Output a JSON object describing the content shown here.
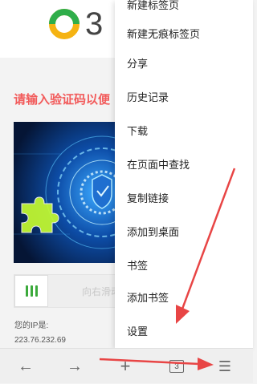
{
  "site": {
    "logo_text": "3",
    "captcha_title": "请输入验证码以便",
    "slider_hint": "向右滑动",
    "ip_label": "您的IP是:",
    "ip_value": "223.76.232.69"
  },
  "menu": {
    "items": [
      {
        "label": "新建标签页"
      },
      {
        "label": "新建无痕标签页"
      },
      {
        "label": "分享"
      },
      {
        "label": "历史记录"
      },
      {
        "label": "下载"
      },
      {
        "label": "在页面中查找"
      },
      {
        "label": "复制链接"
      },
      {
        "label": "添加到桌面"
      },
      {
        "label": "书签"
      },
      {
        "label": "添加书签"
      },
      {
        "label": "设置"
      }
    ]
  },
  "toolbar": {
    "tab_count": "3",
    "back_icon": "←",
    "forward_icon": "→",
    "new_tab_icon": "+",
    "menu_icon": "☰"
  },
  "colors": {
    "arrow": "#e84545",
    "title_red": "#f25a5a",
    "slider_green": "#3caa3c",
    "logo_green": "#2fae4a",
    "logo_yellow": "#f5b312"
  }
}
